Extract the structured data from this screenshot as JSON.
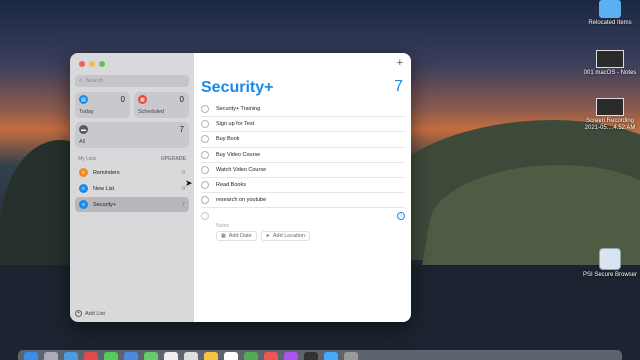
{
  "desktop": {
    "icons": [
      {
        "label": "Relocated Items"
      },
      {
        "label": "001 macOS - Notes"
      },
      {
        "label": "Screen Recording 2021-05....4.52 AM"
      },
      {
        "label": "PSI Secure Browser"
      }
    ]
  },
  "sidebar": {
    "search_placeholder": "Search",
    "smart_lists": [
      {
        "label": "Today",
        "count": "0",
        "color": "#1a8ae6"
      },
      {
        "label": "Scheduled",
        "count": "0",
        "color": "#e6453a"
      },
      {
        "label": "All",
        "count": "7",
        "color": "#5a5a60"
      }
    ],
    "my_lists_label": "My Lists",
    "upgrade_label": "UPGRADE",
    "lists": [
      {
        "name": "Reminders",
        "count": "0",
        "color": "#f08a24"
      },
      {
        "name": "New List",
        "count": "0",
        "color": "#1a8ae6"
      },
      {
        "name": "Security+",
        "count": "7",
        "color": "#1a8ae6"
      }
    ],
    "add_list": "Add List"
  },
  "main": {
    "title": "Security+",
    "count": "7",
    "tasks": [
      "Security+ Training",
      "Sign up for Test",
      "Buy Book",
      "Buy Video Course",
      "Watch Video Course",
      "Read Books",
      "research on youtube"
    ],
    "notes_placeholder": "Notes",
    "add_date": "Add Date",
    "add_location": "Add Location"
  },
  "colors": {
    "accent": "#1a8ae6"
  }
}
